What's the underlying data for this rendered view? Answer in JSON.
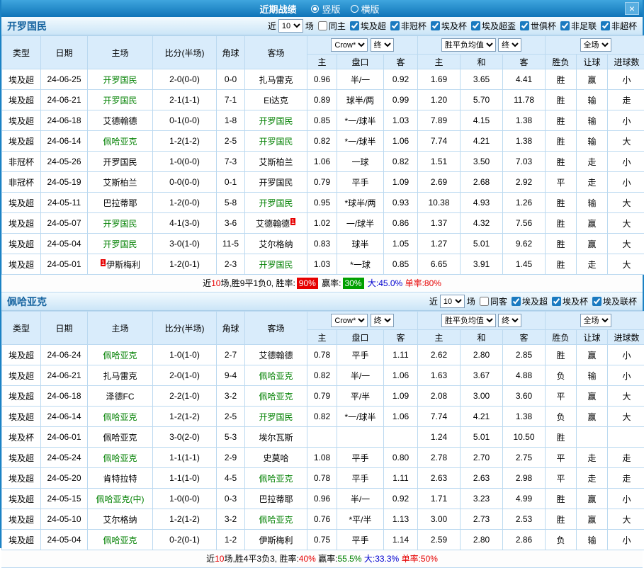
{
  "titlebar": {
    "title": "近期战绩",
    "radios": [
      {
        "label": "竖版",
        "selected": true
      },
      {
        "label": "横版",
        "selected": false
      }
    ],
    "close": "×"
  },
  "colors": {
    "topbar": "#1B82C4",
    "header_bg": "#D9ECFB",
    "type_col_bg": "#D8BE92",
    "league_text": "#8B4513",
    "cup_purple_text": "#C233C2",
    "cup_green_bg": "#2F8A37",
    "focus_team_green": "#008000",
    "score_red": "#E60000",
    "draw_odds_blue": "#0000D0"
  },
  "sections": [
    {
      "team": "开罗国民",
      "filter": {
        "near_label": "近",
        "count": "10",
        "games_label": "场",
        "same_label": "同主",
        "same_checked": false,
        "leagues": [
          {
            "label": "埃及超",
            "checked": true
          },
          {
            "label": "非冠杯",
            "checked": true
          },
          {
            "label": "埃及杯",
            "checked": true
          },
          {
            "label": "埃及超盃",
            "checked": true
          },
          {
            "label": "世俱杯",
            "checked": true
          },
          {
            "label": "非足联",
            "checked": true
          },
          {
            "label": "非超杯",
            "checked": true
          }
        ]
      },
      "header": {
        "col_type": "类型",
        "col_date": "日期",
        "col_home": "主场",
        "col_score": "比分(半场)",
        "col_corner": "角球",
        "col_away": "客场",
        "odds_select": "Crow*",
        "odds_final": "终",
        "eu_select": "胜平负均值",
        "eu_final": "终",
        "scope_select": "全场",
        "sub": [
          "主",
          "盘口",
          "客",
          "主",
          "和",
          "客",
          "胜负",
          "让球",
          "进球数"
        ]
      },
      "rows": [
        {
          "ty": "埃及超",
          "ts": "league",
          "dt": "24-06-25",
          "hm": "开罗国民",
          "hg": true,
          "hb": "",
          "hbp": "",
          "sc": "2-0(0-0)",
          "cn": "0-0",
          "aw": "扎马雷克",
          "ag": false,
          "ab": "",
          "abp": "",
          "lh": "0.96",
          "hc": "半/一",
          "la": "0.92",
          "oh": "1.69",
          "od": "3.65",
          "oa": "4.41",
          "rs": "胜",
          "hr": "赢",
          "gr": "小"
        },
        {
          "ty": "埃及超",
          "ts": "league",
          "dt": "24-06-21",
          "hm": "开罗国民",
          "hg": true,
          "hb": "",
          "hbp": "",
          "sc": "2-1(1-1)",
          "cn": "7-1",
          "aw": "El达克",
          "ag": false,
          "ab": "",
          "abp": "",
          "lh": "0.89",
          "hc": "球半/两",
          "la": "0.99",
          "oh": "1.20",
          "od": "5.70",
          "oa": "11.78",
          "rs": "胜",
          "hr": "输",
          "gr": "走"
        },
        {
          "ty": "埃及超",
          "ts": "league",
          "dt": "24-06-18",
          "hm": "艾德翰德",
          "hg": false,
          "hb": "",
          "hbp": "",
          "sc": "0-1(0-0)",
          "cn": "1-8",
          "aw": "开罗国民",
          "ag": true,
          "ab": "",
          "abp": "",
          "lh": "0.85",
          "hc": "*一/球半",
          "la": "1.03",
          "oh": "7.89",
          "od": "4.15",
          "oa": "1.38",
          "rs": "胜",
          "hr": "输",
          "gr": "小"
        },
        {
          "ty": "埃及超",
          "ts": "league",
          "dt": "24-06-14",
          "hm": "佩哈亚克",
          "hg": true,
          "hb": "",
          "hbp": "",
          "sc": "1-2(1-2)",
          "cn": "2-5",
          "aw": "开罗国民",
          "ag": true,
          "ab": "",
          "abp": "",
          "lh": "0.82",
          "hc": "*一/球半",
          "la": "1.06",
          "oh": "7.74",
          "od": "4.21",
          "oa": "1.38",
          "rs": "胜",
          "hr": "输",
          "gr": "大"
        },
        {
          "ty": "非冠杯",
          "ts": "cupP",
          "dt": "24-05-26",
          "hm": "开罗国民",
          "hg": false,
          "hb": "",
          "hbp": "",
          "sc": "1-0(0-0)",
          "cn": "7-3",
          "aw": "艾斯柏兰",
          "ag": false,
          "ab": "",
          "abp": "",
          "lh": "1.06",
          "hc": "一球",
          "la": "0.82",
          "oh": "1.51",
          "od": "3.50",
          "oa": "7.03",
          "rs": "胜",
          "hr": "走",
          "gr": "小"
        },
        {
          "ty": "非冠杯",
          "ts": "cupP",
          "dt": "24-05-19",
          "hm": "艾斯柏兰",
          "hg": false,
          "hb": "",
          "hbp": "",
          "sc": "0-0(0-0)",
          "cn": "0-1",
          "aw": "开罗国民",
          "ag": false,
          "ab": "",
          "abp": "",
          "lh": "0.79",
          "hc": "平手",
          "la": "1.09",
          "oh": "2.69",
          "od": "2.68",
          "oa": "2.92",
          "rs": "平",
          "hr": "走",
          "gr": "小"
        },
        {
          "ty": "埃及超",
          "ts": "league",
          "dt": "24-05-11",
          "hm": "巴拉蒂耶",
          "hg": false,
          "hb": "",
          "hbp": "",
          "sc": "1-2(0-0)",
          "cn": "5-8",
          "aw": "开罗国民",
          "ag": true,
          "ab": "",
          "abp": "",
          "lh": "0.95",
          "hc": "*球半/两",
          "la": "0.93",
          "oh": "10.38",
          "od": "4.93",
          "oa": "1.26",
          "rs": "胜",
          "hr": "输",
          "gr": "大"
        },
        {
          "ty": "埃及超",
          "ts": "league",
          "dt": "24-05-07",
          "hm": "开罗国民",
          "hg": true,
          "hb": "",
          "hbp": "",
          "sc": "4-1(3-0)",
          "cn": "3-6",
          "aw": "艾德翰德",
          "ag": false,
          "ab": "1",
          "abp": "r",
          "lh": "1.02",
          "hc": "一/球半",
          "la": "0.86",
          "oh": "1.37",
          "od": "4.32",
          "oa": "7.56",
          "rs": "胜",
          "hr": "赢",
          "gr": "大"
        },
        {
          "ty": "埃及超",
          "ts": "league",
          "dt": "24-05-04",
          "hm": "开罗国民",
          "hg": true,
          "hb": "",
          "hbp": "",
          "sc": "3-0(1-0)",
          "cn": "11-5",
          "aw": "艾尔格纳",
          "ag": false,
          "ab": "",
          "abp": "",
          "lh": "0.83",
          "hc": "球半",
          "la": "1.05",
          "oh": "1.27",
          "od": "5.01",
          "oa": "9.62",
          "rs": "胜",
          "hr": "赢",
          "gr": "大"
        },
        {
          "ty": "埃及超",
          "ts": "league",
          "dt": "24-05-01",
          "hm": "伊斯梅利",
          "hg": false,
          "hb": "1",
          "hbp": "l",
          "sc": "1-2(0-1)",
          "cn": "2-3",
          "aw": "开罗国民",
          "ag": true,
          "ab": "",
          "abp": "",
          "lh": "1.03",
          "hc": "*一球",
          "la": "0.85",
          "oh": "6.65",
          "od": "3.91",
          "oa": "1.45",
          "rs": "胜",
          "hr": "走",
          "gr": "大"
        }
      ],
      "summary": [
        {
          "t": "近",
          "c": "sk"
        },
        {
          "t": "10",
          "c": "sr"
        },
        {
          "t": "场,胜9平1负0, 胜率:",
          "c": "sk"
        },
        {
          "t": "90%",
          "c": "badge-r"
        },
        {
          "t": " 赢率:",
          "c": "sk"
        },
        {
          "t": "30%",
          "c": "badge-g"
        },
        {
          "t": " 大:45.0%",
          "c": "sb"
        },
        {
          "t": " 单率:80%",
          "c": "sr"
        }
      ]
    },
    {
      "team": "佩哈亚克",
      "filter": {
        "near_label": "近",
        "count": "10",
        "games_label": "场",
        "same_label": "同客",
        "same_checked": false,
        "leagues": [
          {
            "label": "埃及超",
            "checked": true
          },
          {
            "label": "埃及杯",
            "checked": true
          },
          {
            "label": "埃及联杯",
            "checked": true
          }
        ]
      },
      "header": {
        "col_type": "类型",
        "col_date": "日期",
        "col_home": "主场",
        "col_score": "比分(半场)",
        "col_corner": "角球",
        "col_away": "客场",
        "odds_select": "Crow*",
        "odds_final": "终",
        "eu_select": "胜平负均值",
        "eu_final": "终",
        "scope_select": "全场",
        "sub": [
          "主",
          "盘口",
          "客",
          "主",
          "和",
          "客",
          "胜负",
          "让球",
          "进球数"
        ]
      },
      "rows": [
        {
          "ty": "埃及超",
          "ts": "league",
          "dt": "24-06-24",
          "hm": "佩哈亚克",
          "hg": true,
          "hb": "",
          "hbp": "",
          "sc": "1-0(1-0)",
          "cn": "2-7",
          "aw": "艾德翰德",
          "ag": false,
          "ab": "",
          "abp": "",
          "lh": "0.78",
          "hc": "平手",
          "la": "1.11",
          "oh": "2.62",
          "od": "2.80",
          "oa": "2.85",
          "rs": "胜",
          "hr": "赢",
          "gr": "小"
        },
        {
          "ty": "埃及超",
          "ts": "league",
          "dt": "24-06-21",
          "hm": "扎马雷克",
          "hg": false,
          "hb": "",
          "hbp": "",
          "sc": "2-0(1-0)",
          "cn": "9-4",
          "aw": "佩哈亚克",
          "ag": true,
          "ab": "",
          "abp": "",
          "lh": "0.82",
          "hc": "半/一",
          "la": "1.06",
          "oh": "1.63",
          "od": "3.67",
          "oa": "4.88",
          "rs": "负",
          "hr": "输",
          "gr": "小"
        },
        {
          "ty": "埃及超",
          "ts": "league",
          "dt": "24-06-18",
          "hm": "泽德FC",
          "hg": false,
          "hb": "",
          "hbp": "",
          "sc": "2-2(1-0)",
          "cn": "3-2",
          "aw": "佩哈亚克",
          "ag": true,
          "ab": "",
          "abp": "",
          "lh": "0.79",
          "hc": "平/半",
          "la": "1.09",
          "oh": "2.08",
          "od": "3.00",
          "oa": "3.60",
          "rs": "平",
          "hr": "赢",
          "gr": "大"
        },
        {
          "ty": "埃及超",
          "ts": "league",
          "dt": "24-06-14",
          "hm": "佩哈亚克",
          "hg": true,
          "hb": "",
          "hbp": "",
          "sc": "1-2(1-2)",
          "cn": "2-5",
          "aw": "开罗国民",
          "ag": true,
          "ab": "",
          "abp": "",
          "lh": "0.82",
          "hc": "*一/球半",
          "la": "1.06",
          "oh": "7.74",
          "od": "4.21",
          "oa": "1.38",
          "rs": "负",
          "hr": "赢",
          "gr": "大"
        },
        {
          "ty": "埃及杯",
          "ts": "cupG",
          "dt": "24-06-01",
          "hm": "佩哈亚克",
          "hg": false,
          "hb": "",
          "hbp": "",
          "sc": "3-0(2-0)",
          "cn": "5-3",
          "aw": "埃尔瓦斯",
          "ag": false,
          "ab": "",
          "abp": "",
          "lh": "",
          "hc": "",
          "la": "",
          "oh": "1.24",
          "od": "5.01",
          "oa": "10.50",
          "rs": "胜",
          "hr": "",
          "gr": ""
        },
        {
          "ty": "埃及超",
          "ts": "league",
          "dt": "24-05-24",
          "hm": "佩哈亚克",
          "hg": true,
          "hb": "",
          "hbp": "",
          "sc": "1-1(1-1)",
          "cn": "2-9",
          "aw": "史莫哈",
          "ag": false,
          "ab": "",
          "abp": "",
          "lh": "1.08",
          "hc": "平手",
          "la": "0.80",
          "oh": "2.78",
          "od": "2.70",
          "oa": "2.75",
          "rs": "平",
          "hr": "走",
          "gr": "走"
        },
        {
          "ty": "埃及超",
          "ts": "league",
          "dt": "24-05-20",
          "hm": "肯特拉特",
          "hg": false,
          "hb": "",
          "hbp": "",
          "sc": "1-1(1-0)",
          "cn": "4-5",
          "aw": "佩哈亚克",
          "ag": true,
          "ab": "",
          "abp": "",
          "lh": "0.78",
          "hc": "平手",
          "la": "1.11",
          "oh": "2.63",
          "od": "2.63",
          "oa": "2.98",
          "rs": "平",
          "hr": "走",
          "gr": "走"
        },
        {
          "ty": "埃及超",
          "ts": "league",
          "dt": "24-05-15",
          "hm": "佩哈亚克(中)",
          "hg": true,
          "hb": "",
          "hbp": "",
          "sc": "1-0(0-0)",
          "cn": "0-3",
          "aw": "巴拉蒂耶",
          "ag": false,
          "ab": "",
          "abp": "",
          "lh": "0.96",
          "hc": "半/一",
          "la": "0.92",
          "oh": "1.71",
          "od": "3.23",
          "oa": "4.99",
          "rs": "胜",
          "hr": "赢",
          "gr": "小"
        },
        {
          "ty": "埃及超",
          "ts": "league",
          "dt": "24-05-10",
          "hm": "艾尔格纳",
          "hg": false,
          "hb": "",
          "hbp": "",
          "sc": "1-2(1-2)",
          "cn": "3-2",
          "aw": "佩哈亚克",
          "ag": true,
          "ab": "",
          "abp": "",
          "lh": "0.76",
          "hc": "*平/半",
          "la": "1.13",
          "oh": "3.00",
          "od": "2.73",
          "oa": "2.53",
          "rs": "胜",
          "hr": "赢",
          "gr": "大"
        },
        {
          "ty": "埃及超",
          "ts": "league",
          "dt": "24-05-04",
          "hm": "佩哈亚克",
          "hg": true,
          "hb": "",
          "hbp": "",
          "sc": "0-2(0-1)",
          "cn": "1-2",
          "aw": "伊斯梅利",
          "ag": false,
          "ab": "",
          "abp": "",
          "lh": "0.75",
          "hc": "平手",
          "la": "1.14",
          "oh": "2.59",
          "od": "2.80",
          "oa": "2.86",
          "rs": "负",
          "hr": "输",
          "gr": "小"
        }
      ],
      "summary": [
        {
          "t": "近",
          "c": "sk"
        },
        {
          "t": "10",
          "c": "sr"
        },
        {
          "t": "场,胜4平3负3, 胜率:",
          "c": "sk"
        },
        {
          "t": "40%",
          "c": "sr"
        },
        {
          "t": " 赢率:",
          "c": "sk"
        },
        {
          "t": "55.5%",
          "c": "sg"
        },
        {
          "t": " 大:33.3%",
          "c": "sb"
        },
        {
          "t": " 单率:50%",
          "c": "sr"
        }
      ]
    }
  ]
}
